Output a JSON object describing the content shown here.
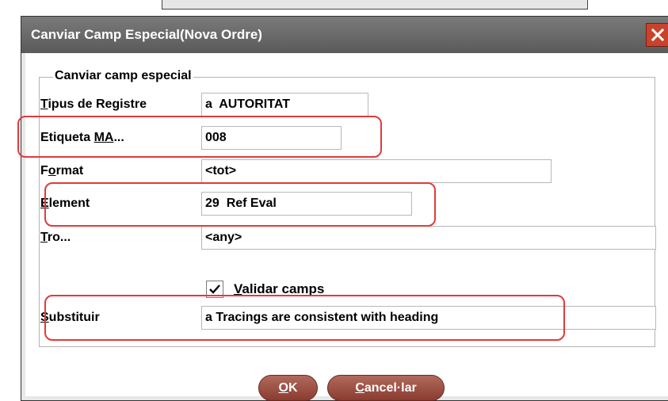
{
  "dialog": {
    "title": "Canviar Camp Especial(Nova Ordre)",
    "group_title": "Canviar camp especial"
  },
  "fields": {
    "tipus_label": "Tipus de Registre",
    "tipus_value": "a  AUTORITAT",
    "etiqueta_label": "Etiqueta MA...",
    "etiqueta_value": "008",
    "format_label": "Format",
    "format_value": "<tot>",
    "element_label": "Element",
    "element_value": "29  Ref Eval",
    "tro_label": "Tro...",
    "tro_value": "<any>",
    "validar_label": "Validar camps",
    "validar_checked": true,
    "substituir_label": "Substituir",
    "substituir_value": "a Tracings are consistent with heading"
  },
  "buttons": {
    "ok": "OK",
    "cancel": "Cancel·lar"
  },
  "colors": {
    "titlebar": "#6b6b6b",
    "button": "#9c4e42",
    "annotation": "#e23a3a"
  }
}
